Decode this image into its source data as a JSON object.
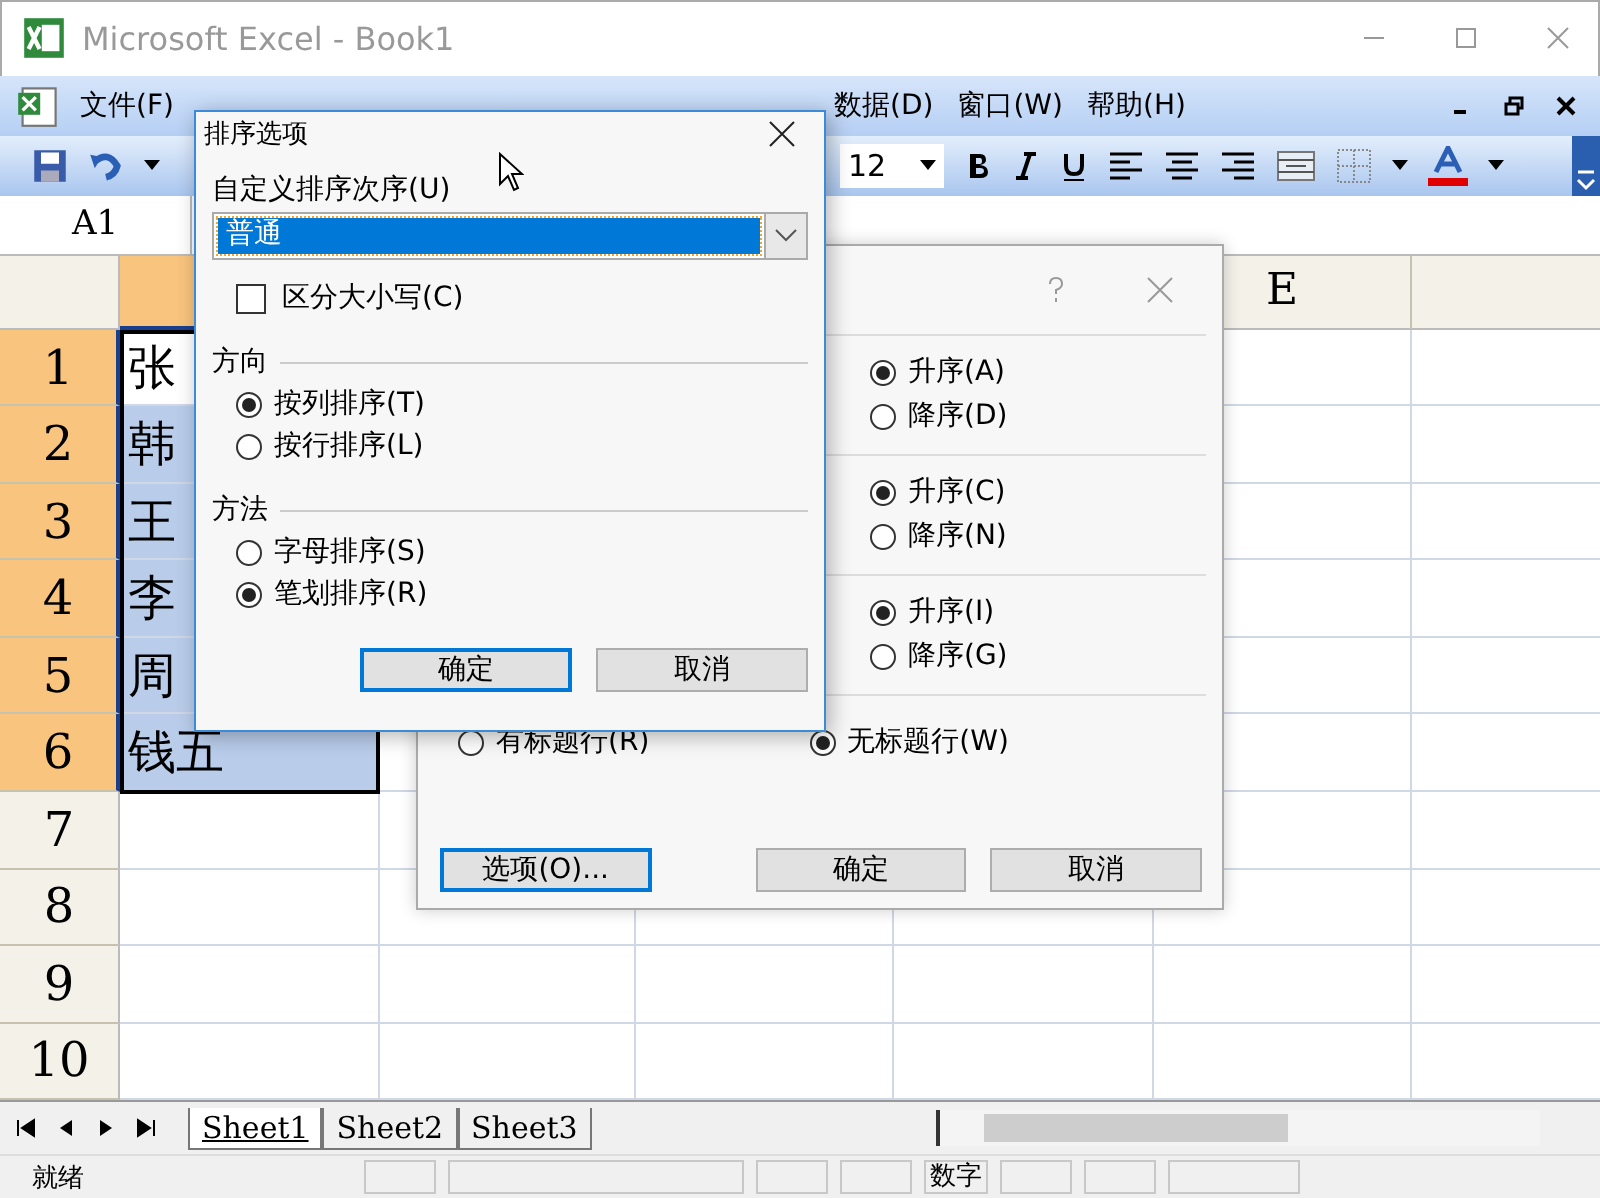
{
  "window": {
    "title": "Microsoft Excel - Book1"
  },
  "menu": [
    {
      "label": "文件(F)"
    },
    {
      "label": "数据(D)"
    },
    {
      "label": "窗口(W)"
    },
    {
      "label": "帮助(H)"
    }
  ],
  "toolbar": {
    "font_size": "12"
  },
  "name_box": "A1",
  "sheet": {
    "columns": [
      {
        "selected": true
      },
      {},
      {},
      {},
      {
        "label": "E",
        "selected": false
      },
      {
        "selected": false
      }
    ],
    "rows": [
      {
        "header": "1",
        "selected": true,
        "cells": [
          {
            "text": "张",
            "active": true
          }
        ]
      },
      {
        "header": "2",
        "selected": true,
        "cells": [
          {
            "text": "韩",
            "active": false
          }
        ]
      },
      {
        "header": "3",
        "selected": true,
        "cells": [
          {
            "text": "王",
            "active": false
          }
        ]
      },
      {
        "header": "4",
        "selected": true,
        "cells": [
          {
            "text": "李",
            "active": false
          }
        ]
      },
      {
        "header": "5",
        "selected": true,
        "cells": [
          {
            "text": "周",
            "active": false
          }
        ]
      },
      {
        "header": "6",
        "selected": true,
        "cells": [
          {
            "text": "钱五",
            "active": false
          }
        ]
      },
      {
        "header": "7",
        "selected": false
      },
      {
        "header": "8",
        "selected": false
      },
      {
        "header": "9",
        "selected": false
      },
      {
        "header": "10",
        "selected": false
      }
    ]
  },
  "sheet_tabs": [
    {
      "label": "Sheet1",
      "selected": true
    },
    {
      "label": "Sheet2",
      "selected": false
    },
    {
      "label": "Sheet3",
      "selected": false
    }
  ],
  "status_bar": {
    "text": "就绪",
    "indicator": "数字"
  },
  "sort_dialog": {
    "sections": [
      {
        "options": [
          {
            "label": "升序(A)",
            "selected": true
          },
          {
            "label": "降序(D)",
            "selected": false
          }
        ]
      },
      {
        "options": [
          {
            "label": "升序(C)",
            "selected": true
          },
          {
            "label": "降序(N)",
            "selected": false
          }
        ]
      },
      {
        "options": [
          {
            "label": "升序(I)",
            "selected": true
          },
          {
            "label": "降序(G)",
            "selected": false
          }
        ]
      }
    ],
    "header_row": [
      {
        "label": "有标题行(R)",
        "selected": false
      },
      {
        "label": "无标题行(W)",
        "selected": true
      }
    ],
    "buttons": [
      {
        "label": "选项(O)...",
        "default": true
      },
      {
        "label": "确定",
        "default": false
      },
      {
        "label": "取消",
        "default": false
      }
    ]
  },
  "options_dialog": {
    "title": "排序选项",
    "order_label": "自定义排序次序(U)",
    "order_value": "普通",
    "case_sensitive": {
      "label": "区分大小写(C)",
      "checked": false
    },
    "groups": [
      {
        "title": "方向",
        "options": [
          {
            "label": "按列排序(T)",
            "selected": true
          },
          {
            "label": "按行排序(L)",
            "selected": false
          }
        ]
      },
      {
        "title": "方法",
        "options": [
          {
            "label": "字母排序(S)",
            "selected": false
          },
          {
            "label": "笔划排序(R)",
            "selected": true
          }
        ]
      }
    ],
    "buttons": [
      {
        "label": "确定",
        "default": true
      },
      {
        "label": "取消",
        "default": false
      }
    ]
  }
}
